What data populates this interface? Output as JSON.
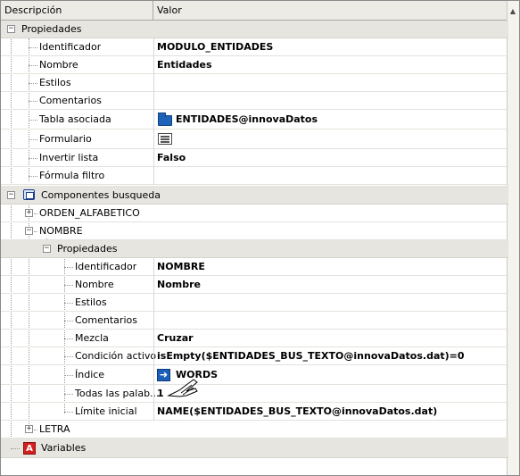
{
  "header": {
    "col_desc": "Descripción",
    "col_val": "Valor"
  },
  "tree": {
    "propiedades": {
      "label": "Propiedades",
      "rows": [
        {
          "label": "Identificador",
          "value": "MODULO_ENTIDADES"
        },
        {
          "label": "Nombre",
          "value": "Entidades"
        },
        {
          "label": "Estilos",
          "value": ""
        },
        {
          "label": "Comentarios",
          "value": ""
        },
        {
          "label": "Tabla asociada",
          "value": "ENTIDADES@innovaDatos",
          "icon": "folder-icon"
        },
        {
          "label": "Formulario",
          "value": "",
          "icon": "form-icon"
        },
        {
          "label": "Invertir lista",
          "value": "Falso"
        },
        {
          "label": "Fórmula filtro",
          "value": ""
        }
      ]
    },
    "componentes": {
      "label": "Componentes busqueda",
      "orden": {
        "label": "ORDEN_ALFABETICO"
      },
      "nombre": {
        "label": "NOMBRE",
        "propiedades_label": "Propiedades",
        "rows": [
          {
            "label": "Identificador",
            "value": "NOMBRE"
          },
          {
            "label": "Nombre",
            "value": "Nombre"
          },
          {
            "label": "Estilos",
            "value": ""
          },
          {
            "label": "Comentarios",
            "value": ""
          },
          {
            "label": "Mezcla",
            "value": "Cruzar"
          },
          {
            "label": "Condición activo",
            "value": "isEmpty($ENTIDADES_BUS_TEXTO@innovaDatos.dat)=0"
          },
          {
            "label": "Índice",
            "value": "WORDS",
            "icon": "index-icon"
          },
          {
            "label": "Todas las palab...",
            "value": "1"
          },
          {
            "label": "Límite inicial",
            "value": "NAME($ENTIDADES_BUS_TEXTO@innovaDatos.dat)"
          }
        ]
      },
      "letra": {
        "label": "LETRA"
      }
    },
    "variables": {
      "label": "Variables",
      "icon_letter": "A"
    }
  },
  "colors": {
    "section_bg": "#e6e5e0",
    "header_bg": "#ecebe6"
  }
}
